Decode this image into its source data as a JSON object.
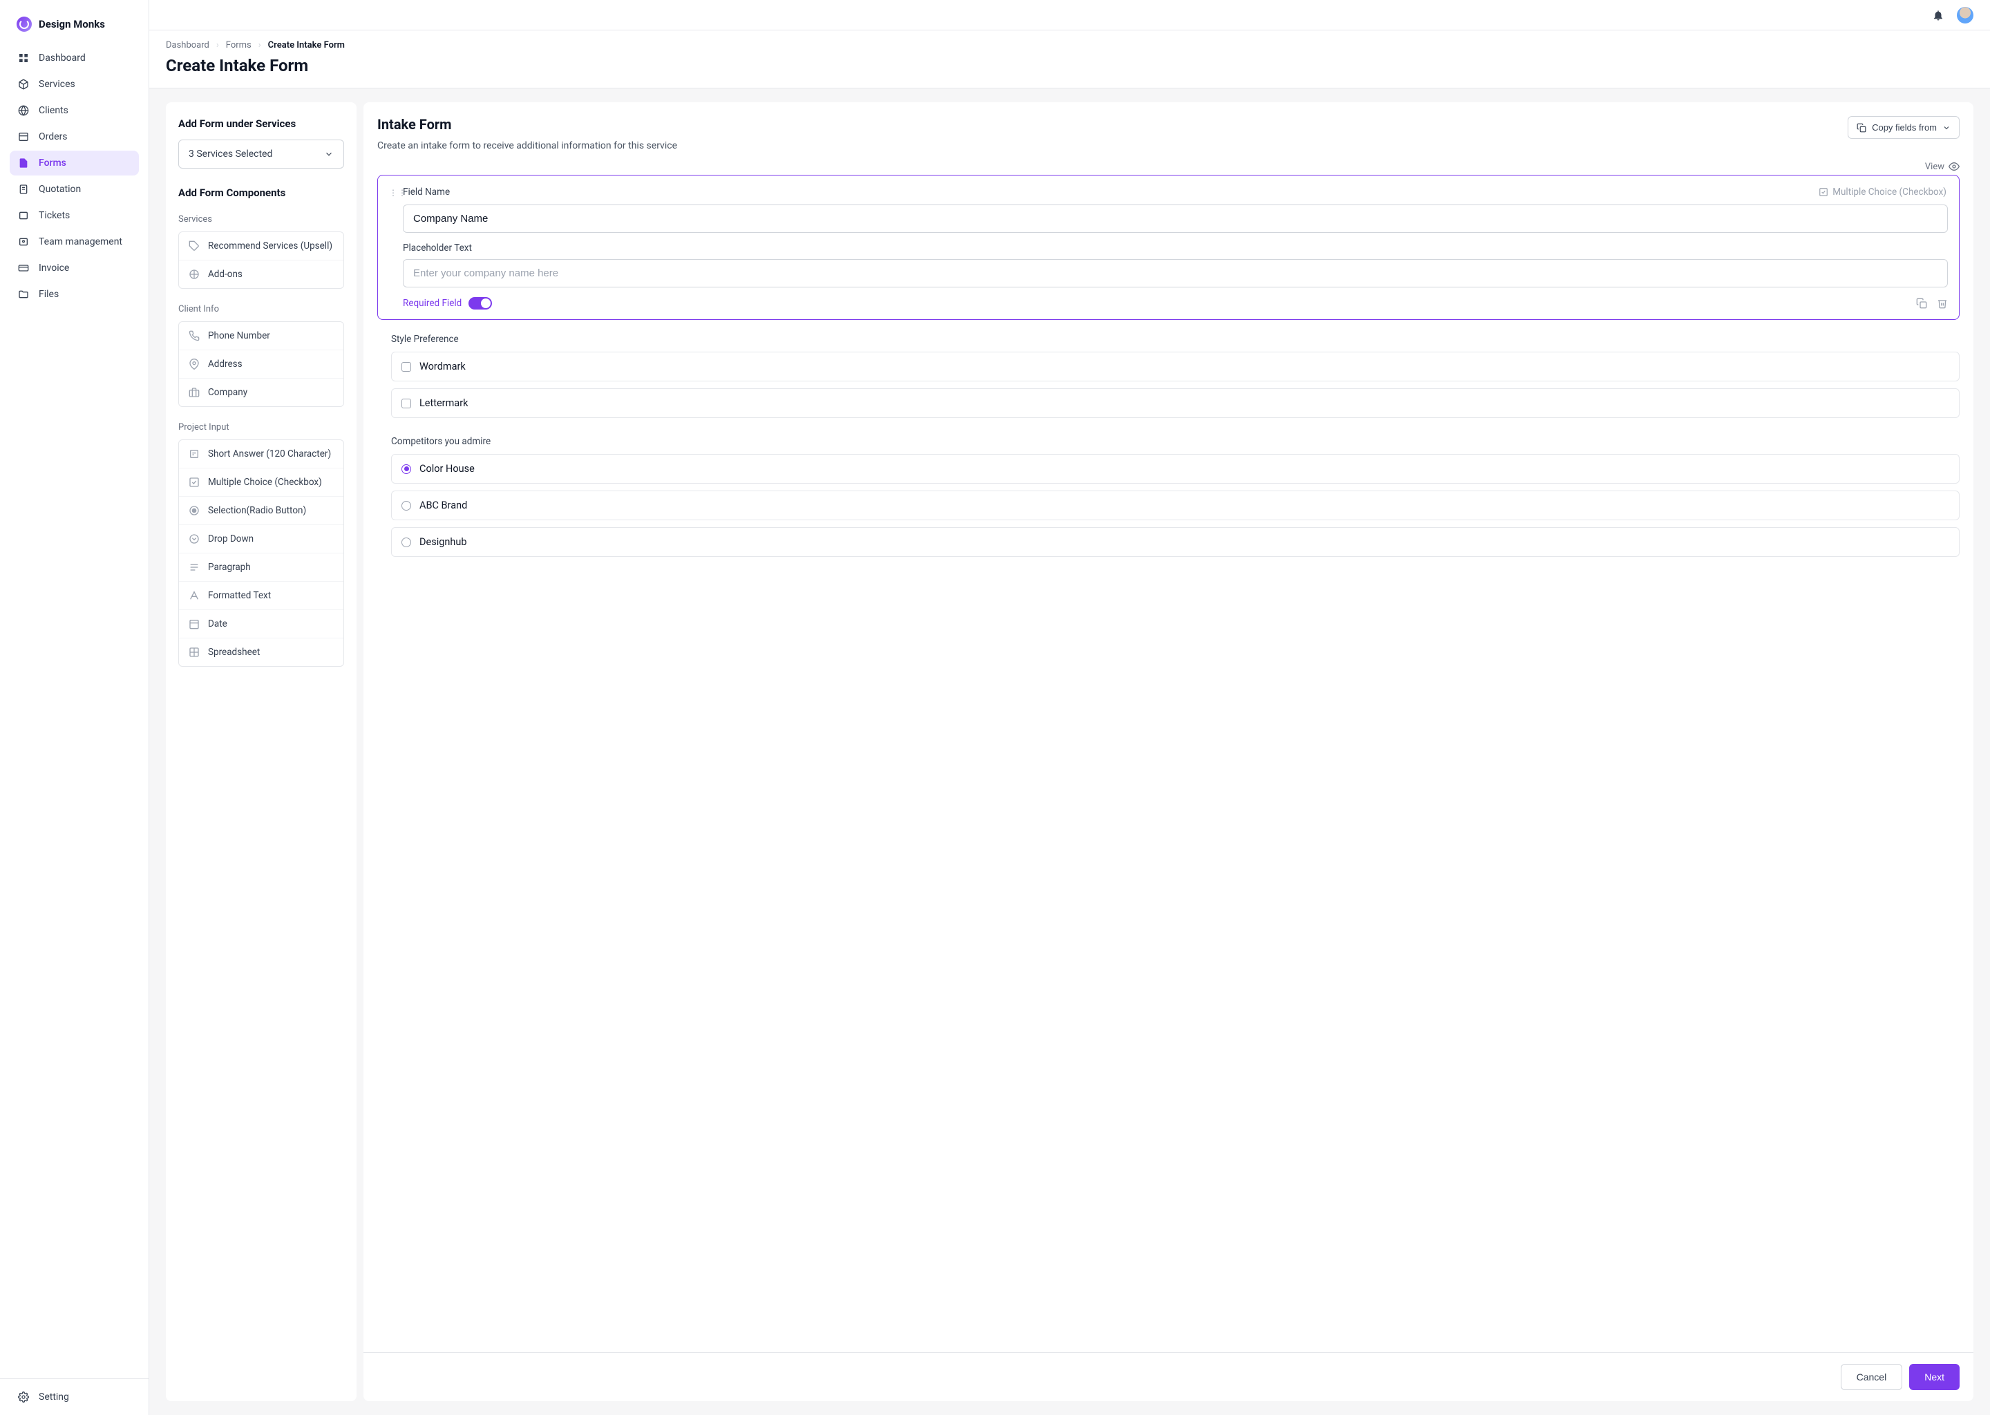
{
  "brand": {
    "name": "Design Monks"
  },
  "nav": [
    {
      "label": "Dashboard",
      "icon": "dashboard"
    },
    {
      "label": "Services",
      "icon": "box"
    },
    {
      "label": "Clients",
      "icon": "globe"
    },
    {
      "label": "Orders",
      "icon": "list"
    },
    {
      "label": "Forms",
      "icon": "file",
      "active": true
    },
    {
      "label": "Quotation",
      "icon": "quote"
    },
    {
      "label": "Tickets",
      "icon": "ticket"
    },
    {
      "label": "Team management",
      "icon": "team"
    },
    {
      "label": "Invoice",
      "icon": "card"
    },
    {
      "label": "Files",
      "icon": "folder"
    }
  ],
  "settings_label": "Setting",
  "breadcrumb": [
    "Dashboard",
    "Forms",
    "Create Intake Form"
  ],
  "page_title": "Create Intake Form",
  "left": {
    "add_under_title": "Add Form under Services",
    "services_selected": "3 Services Selected",
    "components_title": "Add Form Components",
    "groups": [
      {
        "label": "Services",
        "items": [
          {
            "label": "Recommend Services (Upsell)",
            "icon": "tag"
          },
          {
            "label": "Add-ons",
            "icon": "puzzle"
          }
        ]
      },
      {
        "label": "Client Info",
        "items": [
          {
            "label": "Phone Number",
            "icon": "phone"
          },
          {
            "label": "Address",
            "icon": "pin"
          },
          {
            "label": "Company",
            "icon": "briefcase"
          }
        ]
      },
      {
        "label": "Project Input",
        "items": [
          {
            "label": "Short Answer (120 Character)",
            "icon": "short"
          },
          {
            "label": "Multiple Choice (Checkbox)",
            "icon": "checkbox"
          },
          {
            "label": "Selection(Radio Button)",
            "icon": "radio"
          },
          {
            "label": "Drop Down",
            "icon": "dropdown"
          },
          {
            "label": "Paragraph",
            "icon": "paragraph"
          },
          {
            "label": "Formatted Text",
            "icon": "format"
          },
          {
            "label": "Date",
            "icon": "date"
          },
          {
            "label": "Spreadsheet",
            "icon": "sheet"
          }
        ]
      }
    ]
  },
  "right": {
    "title": "Intake Form",
    "subtitle": "Create an intake form to receive additional information for this service",
    "copy_label": "Copy fields from",
    "view_label": "View",
    "editing": {
      "field_name_label": "Field Name",
      "field_type": "Multiple Choice (Checkbox)",
      "field_name_value": "Company Name",
      "placeholder_label": "Placeholder Text",
      "placeholder_value": "Enter your company name here",
      "required_label": "Required Field"
    },
    "preview": [
      {
        "label": "Style Preference",
        "type": "checkbox",
        "options": [
          {
            "text": "Wordmark",
            "checked": false
          },
          {
            "text": "Lettermark",
            "checked": false
          }
        ]
      },
      {
        "label": "Competitors you admire",
        "type": "radio",
        "options": [
          {
            "text": "Color House",
            "checked": true
          },
          {
            "text": "ABC Brand",
            "checked": false
          },
          {
            "text": "Designhub",
            "checked": false
          }
        ]
      }
    ],
    "cancel": "Cancel",
    "next": "Next"
  }
}
